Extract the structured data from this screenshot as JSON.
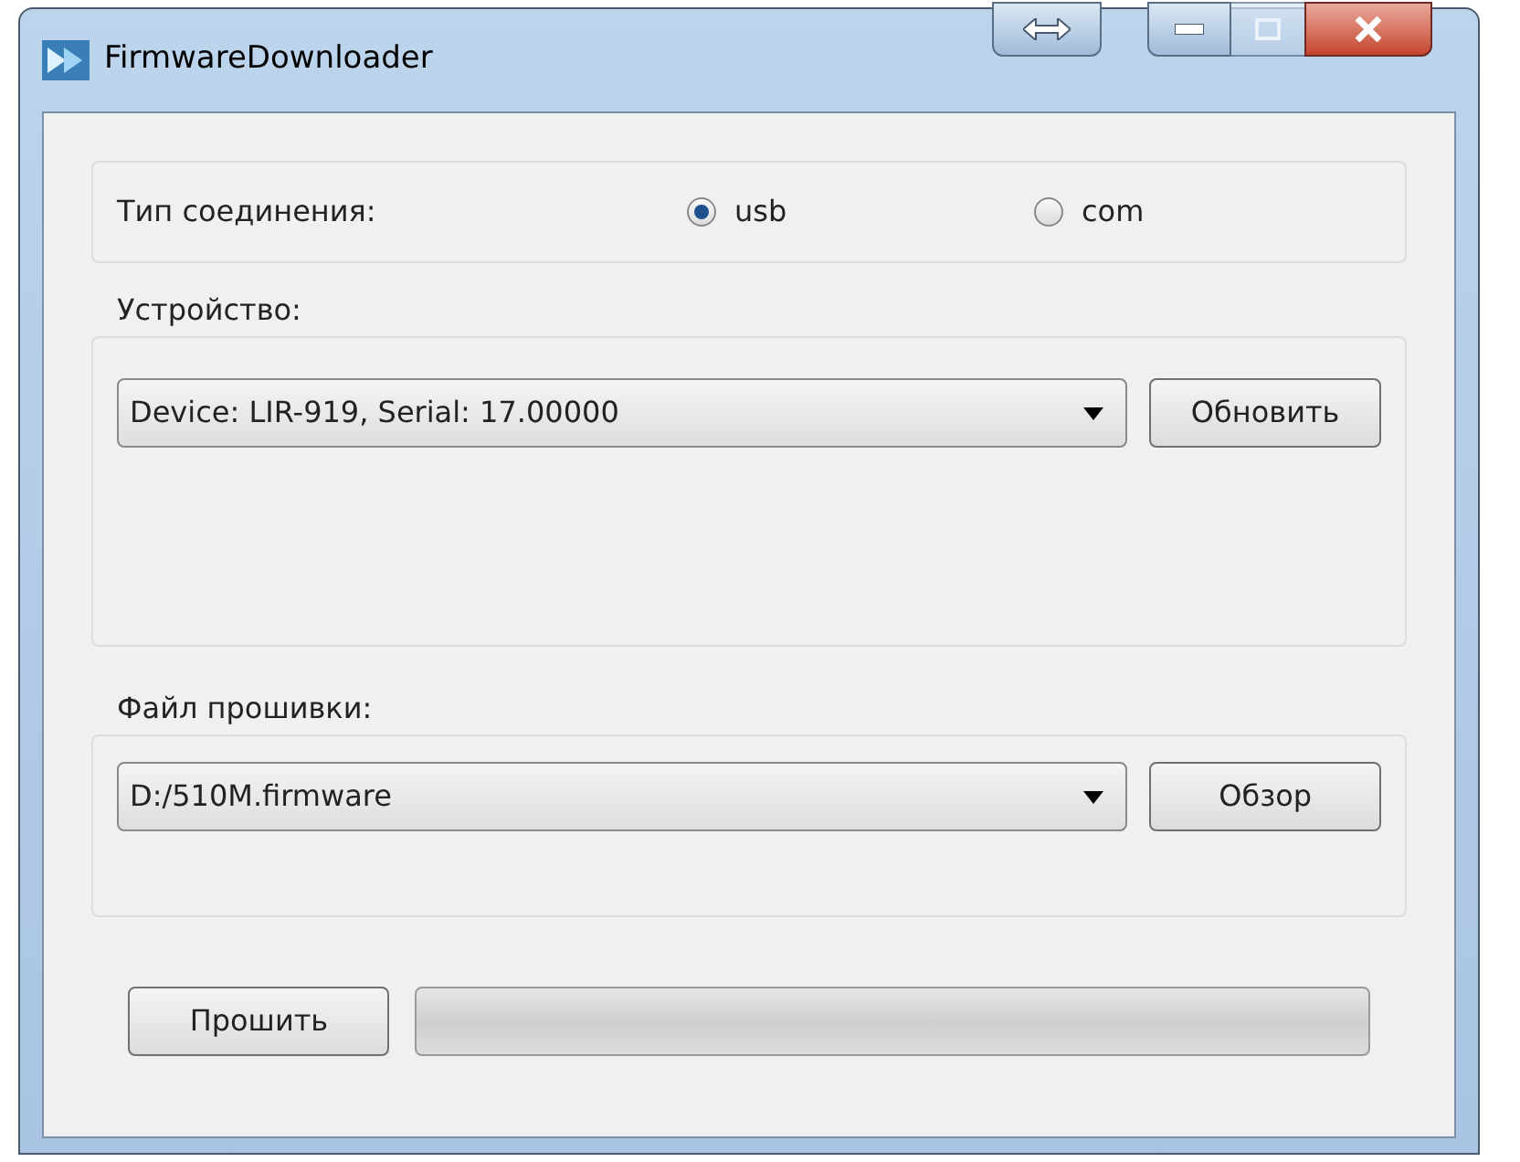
{
  "window": {
    "title": "FirmwareDownloader"
  },
  "connection": {
    "label": "Тип соединения:",
    "options": [
      {
        "label": "usb",
        "selected": true
      },
      {
        "label": "com",
        "selected": false
      }
    ]
  },
  "device": {
    "label": "Устройство:",
    "value": "Device: LIR-919, Serial: 17.00000",
    "button": "Обновить"
  },
  "firmware": {
    "label": "Файл прошивки:",
    "value": "D:/510M.firmware",
    "button": "Обзор"
  },
  "flash_button": "Прошить",
  "progress": {
    "level": 0
  }
}
